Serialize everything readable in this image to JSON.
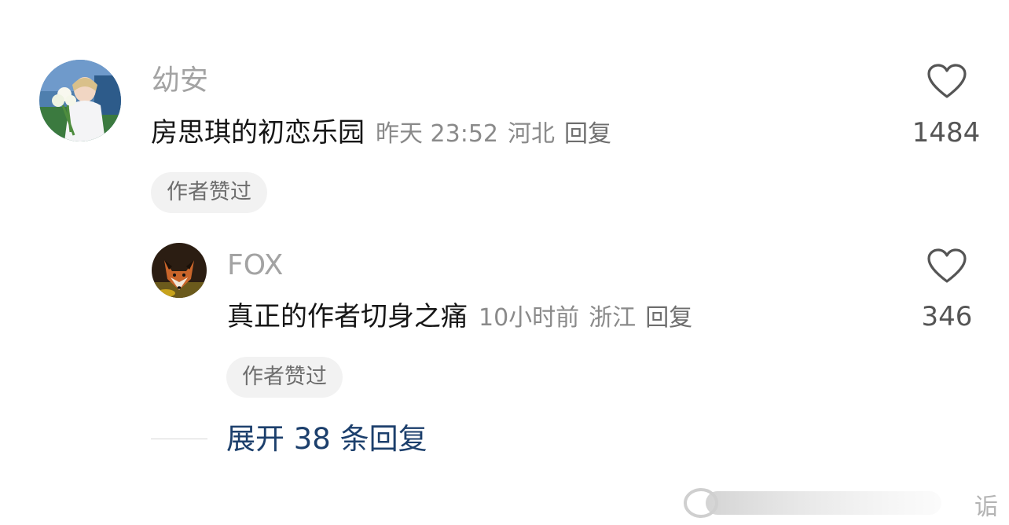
{
  "comments": [
    {
      "username": "幼安",
      "text": "房思琪的初恋乐园",
      "time": "昨天 23:52",
      "location": "河北",
      "reply_label": "回复",
      "badge": "作者赞过",
      "likes": "1484"
    },
    {
      "username": "FOX",
      "text": "真正的作者切身之痛",
      "time": "10小时前",
      "location": "浙江",
      "reply_label": "回复",
      "badge": "作者赞过",
      "likes": "346"
    }
  ],
  "expand_replies": "展开 38 条回复",
  "watermark": "诟",
  "icons": {
    "like": "heart-outline-icon"
  },
  "colors": {
    "link": "#1c3f6c",
    "muted": "#a3a3a3",
    "text": "#161616"
  }
}
